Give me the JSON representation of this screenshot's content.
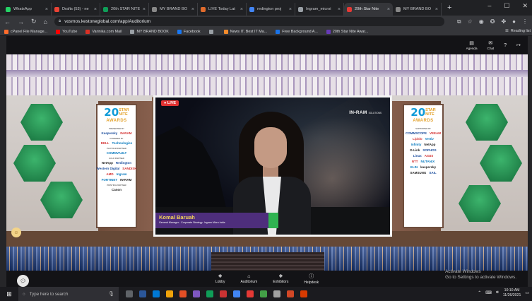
{
  "browser": {
    "tabs": [
      {
        "label": "WhatsApp",
        "color": "#25d366"
      },
      {
        "label": "Drafts (53) - ne",
        "color": "#ea4335"
      },
      {
        "label": "20th STAR NITE",
        "color": "#0f9d58"
      },
      {
        "label": "MY BRAND BO",
        "color": "#888888"
      },
      {
        "label": "LIVE Today Lat",
        "color": "#e06b2c"
      },
      {
        "label": "redington proj",
        "color": "#4285f4"
      },
      {
        "label": "Ingram_microi",
        "color": "#9aa0a6"
      },
      {
        "label": "20th Star Nite",
        "color": "#e53935",
        "active": true
      },
      {
        "label": "MY BRAND BO",
        "color": "#888888"
      }
    ],
    "new_tab": "+",
    "controls": {
      "minimize": "–",
      "maximize": "☐",
      "close": "✕"
    },
    "url": "vosmos.kestoneglobal.com/app/Auditorium",
    "bookmarks": [
      {
        "label": "cPanel File Manage...",
        "color": "#ff6c2c"
      },
      {
        "label": "YouTube",
        "color": "#ff0000"
      },
      {
        "label": "Varinika.com Mail",
        "color": "#d93025"
      },
      {
        "label": "MY BRAND BOOK",
        "color": "#9aa0a6"
      },
      {
        "label": "Facebook",
        "color": "#1877f2"
      },
      {
        "label": "",
        "color": "#9aa0a6"
      },
      {
        "label": "News IT, Best IT Ma...",
        "color": "#f28b2c"
      },
      {
        "label": "Free Background A...",
        "color": "#1a73e8"
      },
      {
        "label": "20th Star Nite Awar...",
        "color": "#673ab7"
      }
    ],
    "reading_list": "Reading list"
  },
  "app": {
    "top_buttons": [
      {
        "label": "Agenda",
        "icon": "agenda-icon"
      },
      {
        "label": "Chat",
        "icon": "chat-icon"
      }
    ],
    "help_icon": "?",
    "logout_icon": "↦",
    "live_badge": "LIVE",
    "banner": {
      "num": "20",
      "star_line1": "STAR",
      "star_line2": "NITE",
      "awards": "AWARDS"
    },
    "left_banner": {
      "sections": [
        {
          "title": "PRESENTED BY",
          "logos": [
            "Kaspersky",
            "IN•RAM"
          ]
        },
        {
          "title": "POWERED BY",
          "logos": [
            "DELL",
            "Technologies"
          ]
        },
        {
          "title": "PLATINUM PARTNER",
          "logos": [
            "COMMVAULT"
          ]
        },
        {
          "title": "GOLD PARTNER",
          "logos": [
            "NetApp",
            "Redington"
          ]
        },
        {
          "title": "",
          "logos": [
            "Western Digital",
            "SANDISK"
          ]
        },
        {
          "title": "",
          "logos": [
            "AMD",
            "Ingram"
          ]
        },
        {
          "title": "",
          "logos": [
            "FORTINET",
            "IN•RAM"
          ]
        },
        {
          "title": "PRINTING PARTNER",
          "logos": [
            "Canon"
          ]
        }
      ]
    },
    "right_banner": {
      "sections": [
        {
          "title": "SUPPORTED BY",
          "logos": [
            "COMMSCOPE",
            "VEEAM"
          ]
        },
        {
          "title": "",
          "logos": [
            "Lipido",
            "Vertiv"
          ]
        },
        {
          "title": "",
          "logos": [
            "Infinity",
            "NetApp"
          ]
        },
        {
          "title": "",
          "logos": [
            "D-Link",
            "SOPHOS"
          ]
        },
        {
          "title": "",
          "logos": [
            "Linux",
            "ASUS"
          ]
        },
        {
          "title": "",
          "logos": [
            "NTT",
            "NUTANIX"
          ]
        },
        {
          "title": "",
          "logos": [
            "ELIN",
            "kaspersky"
          ]
        },
        {
          "title": "",
          "logos": [
            "SAMSUNG",
            "SAIL"
          ]
        }
      ]
    },
    "screen": {
      "brand": "IN•RAM",
      "brand_sub": "SOLUTIONS",
      "speaker_name": "Komal Baruah",
      "speaker_title": "General Manager - Corporate Strategy- Ingram Micro India"
    },
    "nav": [
      {
        "label": "Lobby",
        "icon": "lobby-icon"
      },
      {
        "label": "Auditorium",
        "icon": "auditorium-icon"
      },
      {
        "label": "Exhibitors",
        "icon": "exhibitors-icon"
      },
      {
        "label": "Helpdesk",
        "icon": "helpdesk-icon"
      }
    ],
    "activate": {
      "line1": "Activate Windows",
      "line2": "Go to Settings to activate Windows."
    }
  },
  "taskbar": {
    "search_placeholder": "Type here to search",
    "apps": [
      "#5f6368",
      "#2b579a",
      "#0078d4",
      "#f0a30a",
      "#e34f26",
      "#7e57c2",
      "#0f9d58",
      "#c33",
      "#4285f4",
      "#e53935",
      "#43a047",
      "#a0a0a0",
      "#d24726",
      "#d83b01"
    ],
    "time": "10:10 AM",
    "date": "11/26/2021"
  }
}
